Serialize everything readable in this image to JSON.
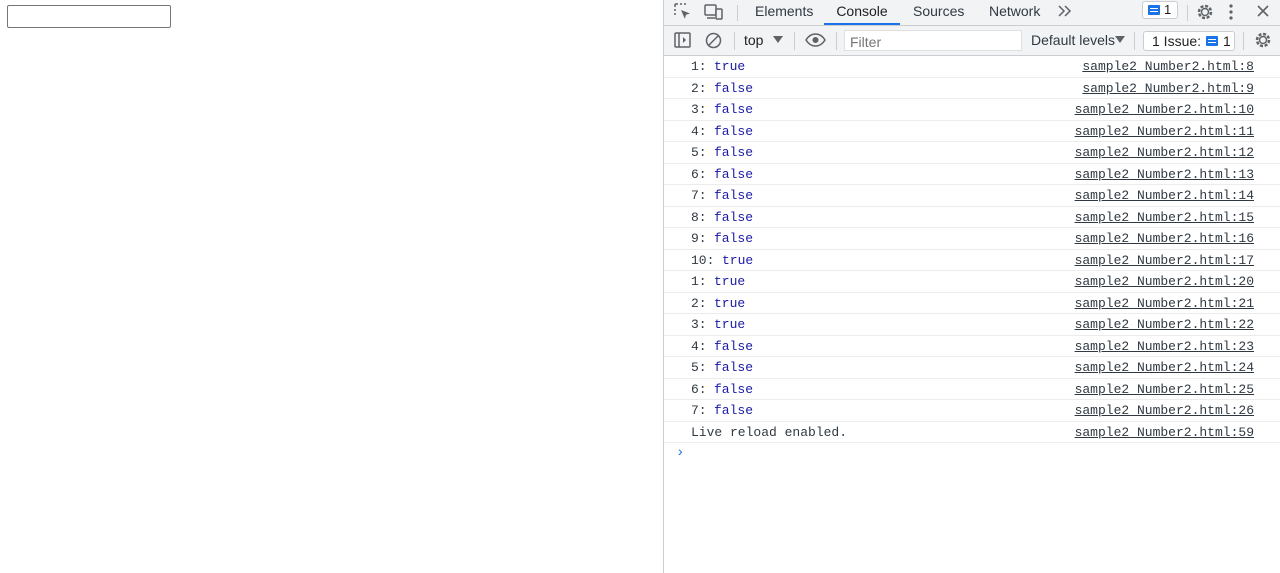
{
  "page": {
    "input_value": ""
  },
  "devtools": {
    "tabs": [
      "Elements",
      "Console",
      "Sources",
      "Network"
    ],
    "active_tab": "Console",
    "messages_badge": "1",
    "toolbar": {
      "context": "top",
      "filter_placeholder": "Filter",
      "levels": "Default levels",
      "issues_label": "1 Issue:",
      "issues_count": "1"
    },
    "console": [
      {
        "num": "1:",
        "val": "true",
        "src": "sample2_Number2.html:8"
      },
      {
        "num": "2:",
        "val": "false",
        "src": "sample2_Number2.html:9"
      },
      {
        "num": "3:",
        "val": "false",
        "src": "sample2_Number2.html:10"
      },
      {
        "num": "4:",
        "val": "false",
        "src": "sample2_Number2.html:11"
      },
      {
        "num": "5:",
        "val": "false",
        "src": "sample2_Number2.html:12"
      },
      {
        "num": "6:",
        "val": "false",
        "src": "sample2_Number2.html:13"
      },
      {
        "num": "7:",
        "val": "false",
        "src": "sample2_Number2.html:14"
      },
      {
        "num": "8:",
        "val": "false",
        "src": "sample2_Number2.html:15"
      },
      {
        "num": "9:",
        "val": "false",
        "src": "sample2_Number2.html:16"
      },
      {
        "num": "10:",
        "val": "true",
        "src": "sample2_Number2.html:17"
      },
      {
        "num": "1:",
        "val": "true",
        "src": "sample2_Number2.html:20"
      },
      {
        "num": "2:",
        "val": "true",
        "src": "sample2_Number2.html:21"
      },
      {
        "num": "3:",
        "val": "true",
        "src": "sample2_Number2.html:22"
      },
      {
        "num": "4:",
        "val": "false",
        "src": "sample2_Number2.html:23"
      },
      {
        "num": "5:",
        "val": "false",
        "src": "sample2_Number2.html:24"
      },
      {
        "num": "6:",
        "val": "false",
        "src": "sample2_Number2.html:25"
      },
      {
        "num": "7:",
        "val": "false",
        "src": "sample2_Number2.html:26"
      }
    ],
    "final_log": {
      "text": "Live reload enabled.",
      "src": "sample2_Number2.html:59"
    },
    "prompt": "›"
  },
  "colors": {
    "accent": "#1a73e8",
    "value_blue": "#1a1aa6",
    "panel_bg": "#f1f3f4",
    "border": "#cbcdd1"
  },
  "icons": [
    "inspect-icon",
    "device-toolbar-icon",
    "more-tabs-icon",
    "message-icon",
    "settings-icon",
    "kebab-menu-icon",
    "close-icon",
    "sidebar-toggle-icon",
    "clear-console-icon",
    "dropdown-arrow-icon",
    "eye-icon",
    "settings-icon"
  ]
}
